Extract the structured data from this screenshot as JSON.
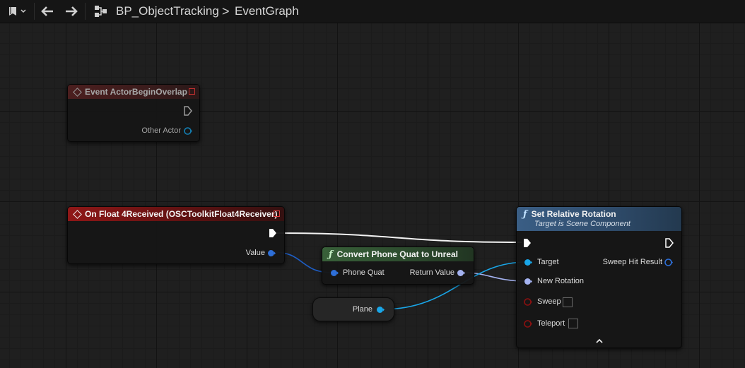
{
  "toolbar": {
    "bookmark_icon": "bookmark-icon",
    "back_icon": "arrow-left-icon",
    "forward_icon": "arrow-right-icon",
    "breadcrumb": {
      "blueprint": "BP_ObjectTracking",
      "separator": ">",
      "graph": "EventGraph"
    }
  },
  "nodes": {
    "begin_overlap": {
      "title": "Event ActorBeginOverlap",
      "pins": {
        "other_actor": "Other Actor"
      }
    },
    "float4_received": {
      "title": "On Float 4Received (OSCToolkitFloat4Receiver)",
      "pins": {
        "value": "Value"
      }
    },
    "convert_quat": {
      "title": "Convert Phone Quat to Unreal",
      "pins": {
        "phone_quat": "Phone Quat",
        "return_value": "Return Value"
      }
    },
    "plane": {
      "label": "Plane"
    },
    "set_rotation": {
      "title": "Set Relative Rotation",
      "subtitle": "Target is Scene Component",
      "pins": {
        "target": "Target",
        "new_rotation": "New Rotation",
        "sweep": "Sweep",
        "teleport": "Teleport",
        "sweep_hit_result": "Sweep Hit Result"
      }
    }
  },
  "colors": {
    "event_header": "#8f1717",
    "function_header": "#3a5e85",
    "pure_header": "#386039",
    "object_pin": "#19a6e8",
    "struct_pin": "#2e6fd8",
    "rotator_pin": "#a4b2f0",
    "bool_pin": "#8c1010",
    "exec_pin": "#ffffff"
  }
}
